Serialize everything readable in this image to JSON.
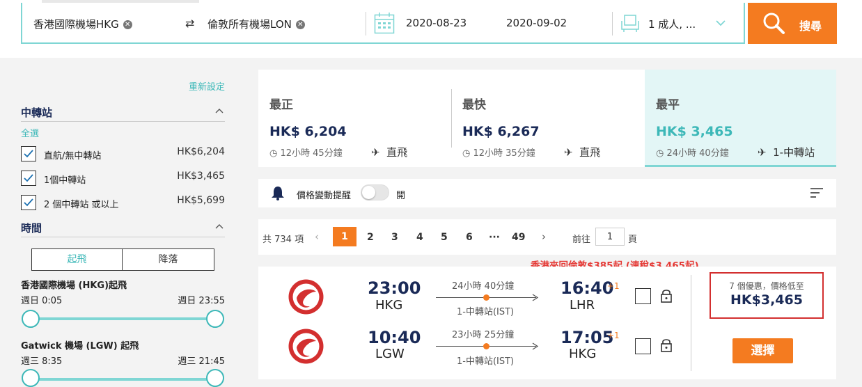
{
  "search": {
    "origin": "香港國際機場HKG",
    "destination": "倫敦所有機場LON",
    "depart_date": "2020-08-23",
    "return_date": "2020-09-02",
    "passengers": "1 成人, ...",
    "search_label": "搜尋"
  },
  "sidebar": {
    "reset": "重新設定",
    "stops_title": "中轉站",
    "select_all": "全選",
    "stops": [
      {
        "label": "直航/無中轉站",
        "price": "HK$6,204"
      },
      {
        "label": "1個中轉站",
        "price": "HK$3,465"
      },
      {
        "label": "2 個中轉站 或以上",
        "price": "HK$5,699"
      }
    ],
    "time_title": "時間",
    "tab_depart": "起飛",
    "tab_arrive": "降落",
    "dep_airport_title": "香港國際機場 (HKG)起飛",
    "dep_min": "週日 0:05",
    "dep_max": "週日 23:55",
    "ret_airport_title": "Gatwick 機場 (LGW) 起飛",
    "ret_min": "週三 8:35",
    "ret_max": "週三 21:45"
  },
  "summary": [
    {
      "title": "最正",
      "price": "HK$ 6,204",
      "duration": "12小時 45分鐘",
      "stops": "直飛"
    },
    {
      "title": "最快",
      "price": "HK$ 6,267",
      "duration": "12小時 35分鐘",
      "stops": "直飛"
    },
    {
      "title": "最平",
      "price": "HK$ 3,465",
      "duration": "24小時 40分鐘",
      "stops": "1-中轉站"
    }
  ],
  "alert": {
    "label": "價格變動提醒",
    "toggle_label": "開"
  },
  "pagination": {
    "total": "共 734 項",
    "pages": [
      "1",
      "2",
      "3",
      "4",
      "5",
      "6",
      "···",
      "49"
    ],
    "goto_label": "前往",
    "goto_value": "1",
    "page_suffix": "頁"
  },
  "result": {
    "promo": "香港來回倫敦$385起 (連稅$3,465起)",
    "outbound": {
      "dep_time": "23:00",
      "dep_code": "HKG",
      "duration": "24小時 40分鐘",
      "stops": "1-中轉站(IST)",
      "arr_time": "16:40",
      "plus_day": "+1",
      "arr_code": "LHR"
    },
    "inbound": {
      "dep_time": "10:40",
      "dep_code": "LGW",
      "duration": "23小時 25分鐘",
      "stops": "1-中轉站(IST)",
      "arr_time": "17:05",
      "plus_day": "+1",
      "arr_code": "HKG"
    },
    "deals": "7 個優惠，價格低至",
    "price": "HK$3,465",
    "select_label": "選擇"
  },
  "colors": {
    "accent": "#f47b20",
    "teal": "#3db8b8",
    "navy": "#1a2a57",
    "red_border": "#d32f2f"
  }
}
